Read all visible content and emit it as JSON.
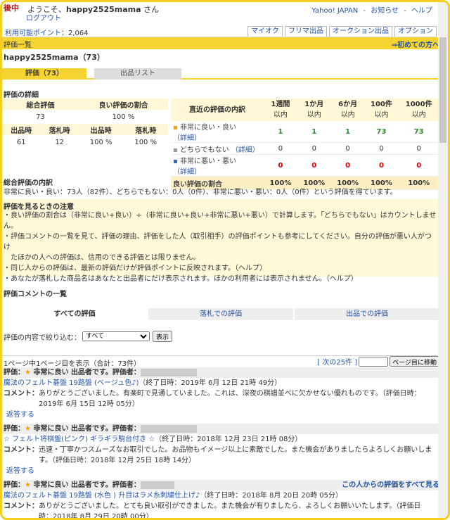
{
  "header": {
    "logo": "後中",
    "welcome_prefix": "ようこそ、",
    "username": "happy2525mama",
    "welcome_suffix": " さん",
    "logout": "ログアウト",
    "links": [
      "Yahoo! JAPAN",
      "-",
      "お知らせ",
      "-",
      "ヘルプ"
    ]
  },
  "points": {
    "label": "利用可能ポイント",
    "value": "：2,064"
  },
  "nav_tabs": [
    "マイオク",
    "フリマ出品",
    "オークション出品",
    "オプション"
  ],
  "section": {
    "title": "評価一覧",
    "first_time": "初めての方へ"
  },
  "profile": {
    "name": "happy2525mama（73）"
  },
  "tabs": {
    "rating": "評価（73）",
    "listing": "出品リスト"
  },
  "details": {
    "title": "評価の詳細",
    "left": {
      "h1": "総合評価",
      "h2": "良い評価の割合",
      "v1": "73",
      "v2": "100 %",
      "sub": [
        "出品時",
        "落札時",
        "出品時",
        "落札時"
      ],
      "subv": [
        "61",
        "12",
        "100 %",
        "100 %"
      ]
    },
    "right": {
      "header": "直近の評価の内訳",
      "periods": [
        [
          "1週間",
          "以内"
        ],
        [
          "1か月",
          "以内"
        ],
        [
          "6か月",
          "以内"
        ],
        [
          "100件",
          "以内"
        ],
        [
          "1000件",
          "以内"
        ]
      ],
      "rows": [
        {
          "label": "非常に良い・良い",
          "link": "（詳細）",
          "values": [
            "1",
            "1",
            "1",
            "73",
            "73"
          ],
          "cls": "g"
        },
        {
          "label": "どちらでもない",
          "link": "（詳細）",
          "values": [
            "0",
            "0",
            "0",
            "0",
            "0"
          ],
          "cls": ""
        },
        {
          "label": "非常に悪い・悪い",
          "link": "（詳細）",
          "values": [
            "0",
            "0",
            "0",
            "0",
            "0"
          ],
          "cls": "rd"
        }
      ],
      "sum_label": "良い評価の割合",
      "sum": [
        "100%",
        "100%",
        "100%",
        "100%",
        "100%"
      ]
    }
  },
  "breakdown": {
    "title": "総合評価の内訳",
    "text": "非常に良い・良い：73人（82件）、どちらでもない：0人（0件）、非常に悪い・悪い：0人（0件）という評価を得ています。"
  },
  "notes": {
    "title": "評価を見るときの注意",
    "items": [
      "・良い評価の割合は（非常に良い+良い）÷（非常に良い+良い+非常に悪い+悪い）で計算します。「どちらでもない」はカウントしません。",
      "・評価コメントの一覧を見て、評価の理由、評価をした人（取引相手）の評価ポイントも参考にしてください。自分の評価が悪い人がつけ",
      "　たほかの人への評価は、信用のできる評価とは限りません。",
      "・同じ人からの評価は、最新の評価だけが評価ポイントに反映されます。（ヘルプ）",
      "・あなたが落札した商品名はあなたと出品者にだけ表示されます。ほかの利用者には表示されません。（ヘルプ）"
    ]
  },
  "comments": {
    "title": "評価コメントの一覧",
    "tabs": [
      "すべての評価",
      "落札での評価",
      "出品での評価"
    ],
    "filter_label": "評価の内容で絞り込む：",
    "filter_value": "すべて",
    "filter_btn": "表示",
    "pager_left": "1ページ中1ページ目を表示（合計：73件）",
    "pager_next": "[ 次の25件 ]",
    "pager_btn": "ページ目に移動"
  },
  "entries": [
    {
      "head": "評価：",
      "level": "非常に良い",
      "role": "出品者です。評価者：",
      "item": "魔法のフェルト碁盤 19路盤 (ベージュ色♪)",
      "end": "（終了日時：2019年 6月 12日 21時 49分）",
      "ck": "コメント：",
      "c1": "ありがとうございました。有楽町で見通していました。これは、深夜の棋譜並べに欠かせない優れものです。（評価日時：",
      "c2": "2019年 6月 15日 12時 05分）",
      "reply": "返答する",
      "rlink": ""
    },
    {
      "head": "評価：",
      "level": "非常に良い",
      "role": "出品者です。評価者：",
      "item": "☆ フェルト将棋盤(ピンク) ギラギラ駒台付き ☆",
      "end": "（終了日時：2018年 12月 23日 21時 08分）",
      "ck": "コメント：",
      "c1": "迅速・丁寧かつスムーズなお取引でした。お品物もイメージ以上に素敵でした。また機会がありましたらよろしくお願いしま",
      "c2": "す。（評価日時：2018年 12月 25日 18時 14分）",
      "reply": "返答する",
      "rlink": ""
    },
    {
      "head": "評価：",
      "level": "非常に良い",
      "role": "出品者です。評価者：",
      "item": "魔法のフェルト碁盤 19路盤 (水色 ) 升目はラメ糸刺繍仕上げ♪",
      "end": "（終了日時：2018年 8月 20日 20時 05分）",
      "ck": "コメント：",
      "c1": "ありがとうございました。とても良い取引ができました。また機会が有りましたら、よろしくお願いいたします。（評価日",
      "c2": "時：2018年 8月 29日 20時 00分）",
      "reply": "",
      "rlink": "この人からの評価をすべて見る"
    }
  ]
}
